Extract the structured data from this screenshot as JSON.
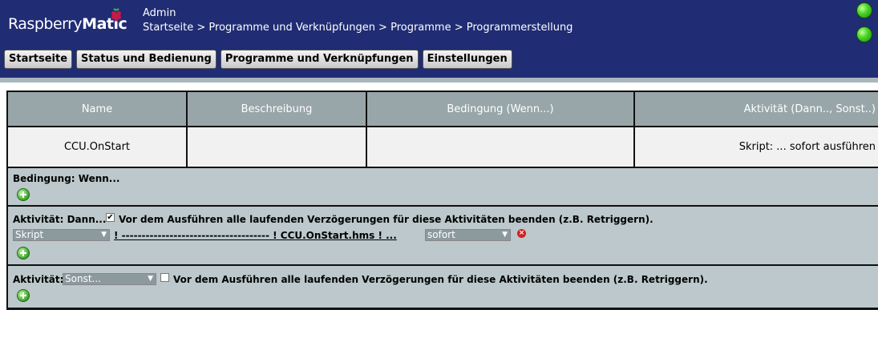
{
  "header": {
    "logo_regular": "Raspberry",
    "logo_bold": "Matic",
    "user": "Admin",
    "breadcrumb": "Startseite > Programme und Verknüpfungen > Programme > Programmerstellung"
  },
  "nav": [
    "Startseite",
    "Status und Bedienung",
    "Programme und Verknüpfungen",
    "Einstellungen"
  ],
  "table": {
    "headers": [
      "Name",
      "Beschreibung",
      "Bedingung (Wenn...)",
      "Aktivität (Dann.., Sonst..)"
    ],
    "row": [
      "CCU.OnStart",
      "",
      "",
      "Skript: ... sofort ausführen"
    ]
  },
  "condition": {
    "label": "Bedingung: Wenn..."
  },
  "activity_then": {
    "label": "Aktivität: Dann...",
    "checkbox_checked": true,
    "checkbox_label": "Vor dem Ausführen alle laufenden Verzögerungen für diese Aktivitäten beenden (z.B. Retriggern).",
    "type_select": "Skript",
    "script_link": "! ------------------------------------- ! CCU.OnStart.hms ! ...",
    "timing_select": "sofort"
  },
  "activity_else": {
    "label": "Aktivität:",
    "select": "Sonst...",
    "checkbox_checked": false,
    "checkbox_label": "Vor dem Ausführen alle laufenden Verzögerungen für diese Aktivitäten beenden (z.B. Retriggern)."
  }
}
